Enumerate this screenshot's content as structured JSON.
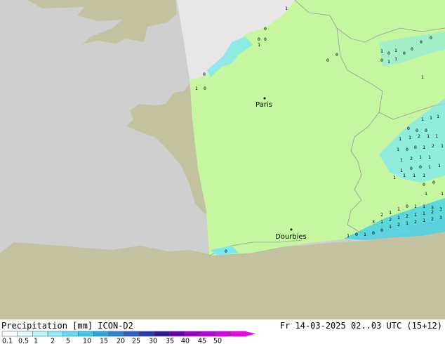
{
  "map": {
    "colors": {
      "sea": "#cfcfcf",
      "land_outside": "#c2c2a0",
      "model_domain": "#c6f7a0",
      "no_data": "#e7e7e7",
      "border": "#9a9a9a",
      "light_rain": "#7ee8f0",
      "rain": "#49d2e6"
    },
    "cities": [
      {
        "id": "paris",
        "label": "Paris"
      },
      {
        "id": "dourbies",
        "label": "Dourbies"
      }
    ],
    "values_north": [
      "1",
      "0",
      "0",
      "1",
      "0",
      "0",
      "1",
      "0",
      "1",
      "0",
      "1",
      "0",
      "1",
      "1",
      "0",
      "0",
      "0",
      "0",
      "0",
      "0",
      "1"
    ],
    "values_east": [
      "1",
      "1",
      "1",
      "0",
      "0",
      "0",
      "1",
      "1",
      "2",
      "1",
      "1",
      "1",
      "0",
      "0",
      "1",
      "2",
      "1",
      "1",
      "2",
      "1",
      "1",
      "1",
      "0",
      "0",
      "1",
      "1",
      "1",
      "1",
      "1",
      "1",
      "0",
      "0",
      "1",
      "1"
    ],
    "values_south": [
      "1",
      "0",
      "1",
      "0",
      "0",
      "1",
      "2",
      "1",
      "2",
      "1",
      "2",
      "3",
      "3",
      "1",
      "2",
      "1",
      "2",
      "1",
      "1",
      "2",
      "1",
      "1",
      "3",
      "0",
      "1",
      "1",
      "2",
      "3",
      "0"
    ]
  },
  "footer": {
    "title": "Precipitation [mm]  ICON-D2",
    "timestamp": "Fr 14-03-2025 02..03 UTC (15+12)"
  },
  "legend": {
    "colors": [
      "#ffffff",
      "#dffaff",
      "#b6f3fb",
      "#8fe9f6",
      "#63daf0",
      "#3cc8e8",
      "#2aa6dc",
      "#2b84d2",
      "#2a5ec6",
      "#263cb7",
      "#2d1b9d",
      "#6d00bc",
      "#9400d6",
      "#b800e6",
      "#d600ee",
      "#ef00f0"
    ],
    "labels": [
      "0.1",
      "0.5",
      "1",
      "2",
      "5",
      "10",
      "15",
      "20",
      "25",
      "30",
      "35",
      "40",
      "45",
      "50"
    ]
  }
}
